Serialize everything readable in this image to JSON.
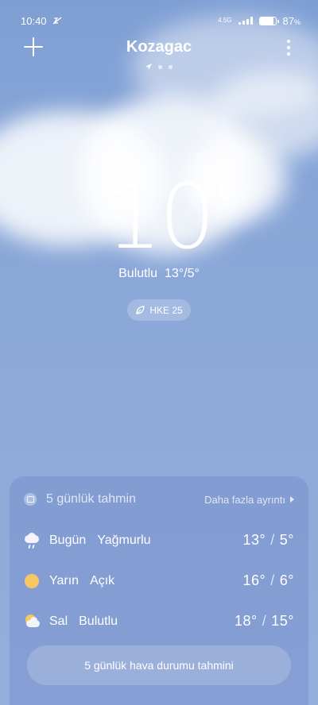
{
  "status_bar": {
    "time": "10:40",
    "network": "4.5G",
    "battery_percent": "87",
    "battery_unit": "%",
    "battery_level": 0.87
  },
  "header": {
    "city": "Kozagac",
    "page_count": 3
  },
  "current": {
    "temperature": "10",
    "unit": "°C",
    "condition": "Bulutlu",
    "range": "13°/5°",
    "aqi": "HKE 25"
  },
  "forecast": {
    "title": "5 günlük tahmin",
    "more_label": "Daha fazla ayrıntı",
    "days": [
      {
        "day": "Bugün",
        "condition": "Yağmurlu",
        "high": "13°",
        "low": "5°",
        "icon": "rain-cloud-icon"
      },
      {
        "day": "Yarın",
        "condition": "Açık",
        "high": "16°",
        "low": "6°",
        "icon": "sun-icon"
      },
      {
        "day": "Sal",
        "condition": "Bulutlu",
        "high": "18°",
        "low": "15°",
        "icon": "partly-cloudy-icon"
      }
    ],
    "sep": "/",
    "button_label": "5 günlük hava durumu tahmini"
  },
  "colors": {
    "sky": "#87a5d7",
    "sun": "#f7c862"
  }
}
